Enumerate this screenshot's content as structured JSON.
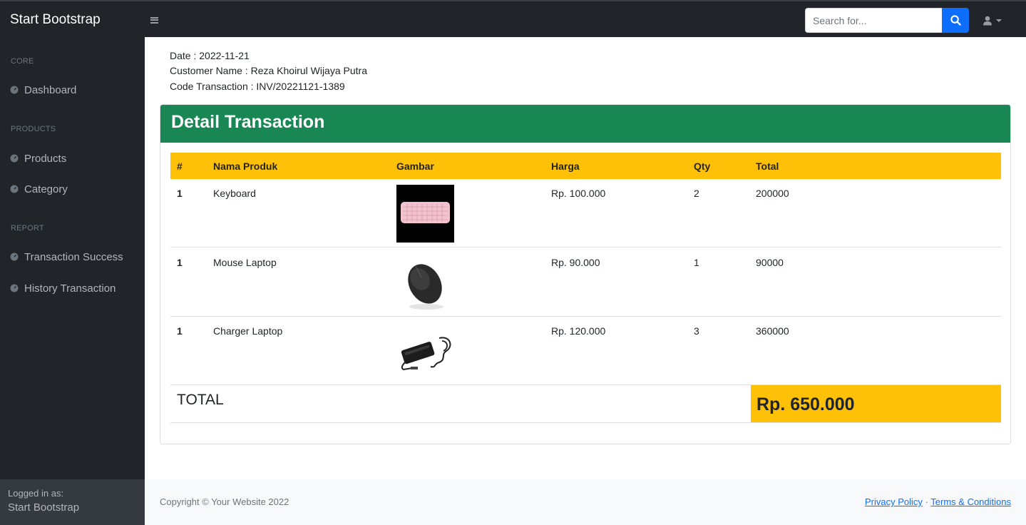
{
  "navbar": {
    "brand": "Start Bootstrap",
    "search_placeholder": "Search for..."
  },
  "sidebar": {
    "sections": [
      {
        "heading": "Core",
        "items": [
          {
            "label": "Dashboard",
            "icon": "tachometer-icon"
          }
        ]
      },
      {
        "heading": "Products",
        "items": [
          {
            "label": "Products",
            "icon": "tachometer-icon"
          },
          {
            "label": "Category",
            "icon": "tachometer-icon"
          }
        ]
      },
      {
        "heading": "Report",
        "items": [
          {
            "label": "Transaction Success",
            "icon": "tachometer-icon"
          },
          {
            "label": "History Transaction",
            "icon": "tachometer-icon"
          }
        ]
      }
    ],
    "footer": {
      "label": "Logged in as:",
      "user": "Start Bootstrap"
    }
  },
  "info": {
    "date": "Date : 2022-11-21",
    "customer": "Customer Name : Reza Khoirul Wijaya Putra",
    "code": "Code Transaction : INV/20221121-1389"
  },
  "card": {
    "title": "Detail Transaction",
    "columns": [
      "#",
      "Nama Produk",
      "Gambar",
      "Harga",
      "Qty",
      "Total"
    ],
    "rows": [
      {
        "no": "1",
        "name": "Keyboard",
        "image": "keyboard-image",
        "price": "Rp. 100.000",
        "qty": "2",
        "total": "200000"
      },
      {
        "no": "1",
        "name": "Mouse Laptop",
        "image": "mouse-image",
        "price": "Rp. 90.000",
        "qty": "1",
        "total": "90000"
      },
      {
        "no": "1",
        "name": "Charger Laptop",
        "image": "charger-image",
        "price": "Rp. 120.000",
        "qty": "3",
        "total": "360000"
      }
    ],
    "total_label": "TOTAL",
    "total_value": "Rp. 650.000"
  },
  "footer": {
    "copyright": "Copyright © Your Website 2022",
    "privacy": "Privacy Policy",
    "separator": "·",
    "terms": "Terms & Conditions"
  },
  "colors": {
    "sidebar": "#212529",
    "card_header": "#198754",
    "table_header": "#ffc107",
    "search_button": "#0d6efd"
  }
}
